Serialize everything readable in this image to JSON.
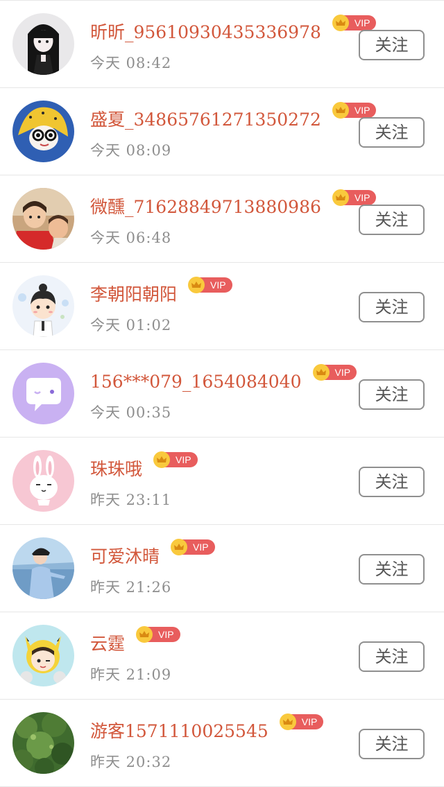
{
  "follow_list": {
    "items": [
      {
        "name": "昕昕_95610930435336978",
        "vip_label": "VIP",
        "time": "今天  08:42",
        "follow_label": "关注",
        "avatar_icon": "avatar-dark-hair-girl-icon",
        "avatar_bg": "#e9e8ea"
      },
      {
        "name": "盛夏_34865761271350272",
        "vip_label": "VIP",
        "time": "今天  08:09",
        "follow_label": "关注",
        "avatar_icon": "avatar-yellow-headscarf-icon",
        "avatar_bg": "#2f5fb3"
      },
      {
        "name": "微醺_71628849713880986",
        "vip_label": "VIP",
        "time": "今天  06:48",
        "follow_label": "关注",
        "avatar_icon": "avatar-children-photo-icon",
        "avatar_bg": "#c9a57e"
      },
      {
        "name": "李朝阳朝阳",
        "vip_label": "VIP",
        "time": "今天  01:02",
        "follow_label": "关注",
        "avatar_icon": "avatar-cartoon-boy-icon",
        "avatar_bg": "#eef3fa"
      },
      {
        "name": "156***079_1654084040",
        "vip_label": "VIP",
        "time": "今天  00:35",
        "follow_label": "关注",
        "avatar_icon": "avatar-chat-bubble-icon",
        "avatar_bg": "#c9b1f2"
      },
      {
        "name": "珠珠哦",
        "vip_label": "VIP",
        "time": "昨天  23:11",
        "follow_label": "关注",
        "avatar_icon": "avatar-white-rabbit-icon",
        "avatar_bg": "#f7c7d3"
      },
      {
        "name": "可爱沐晴",
        "vip_label": "VIP",
        "time": "昨天  21:26",
        "follow_label": "关注",
        "avatar_icon": "avatar-beach-photo-icon",
        "avatar_bg": "#8fb6d8"
      },
      {
        "name": "云霆",
        "vip_label": "VIP",
        "time": "昨天  21:09",
        "follow_label": "关注",
        "avatar_icon": "avatar-pikachu-hood-boy-icon",
        "avatar_bg": "#bfe7ee"
      },
      {
        "name": "游客1571110025545",
        "vip_label": "VIP",
        "time": "昨天  20:32",
        "follow_label": "关注",
        "avatar_icon": "avatar-green-tree-icon",
        "avatar_bg": "#3f6b2e"
      }
    ]
  },
  "colors": {
    "name_red": "#d2573b",
    "vip_pill": "#e85d5d",
    "vip_crown": "#f9c93d",
    "time_gray": "#8e8e8e",
    "divider": "#e6e6e6"
  }
}
